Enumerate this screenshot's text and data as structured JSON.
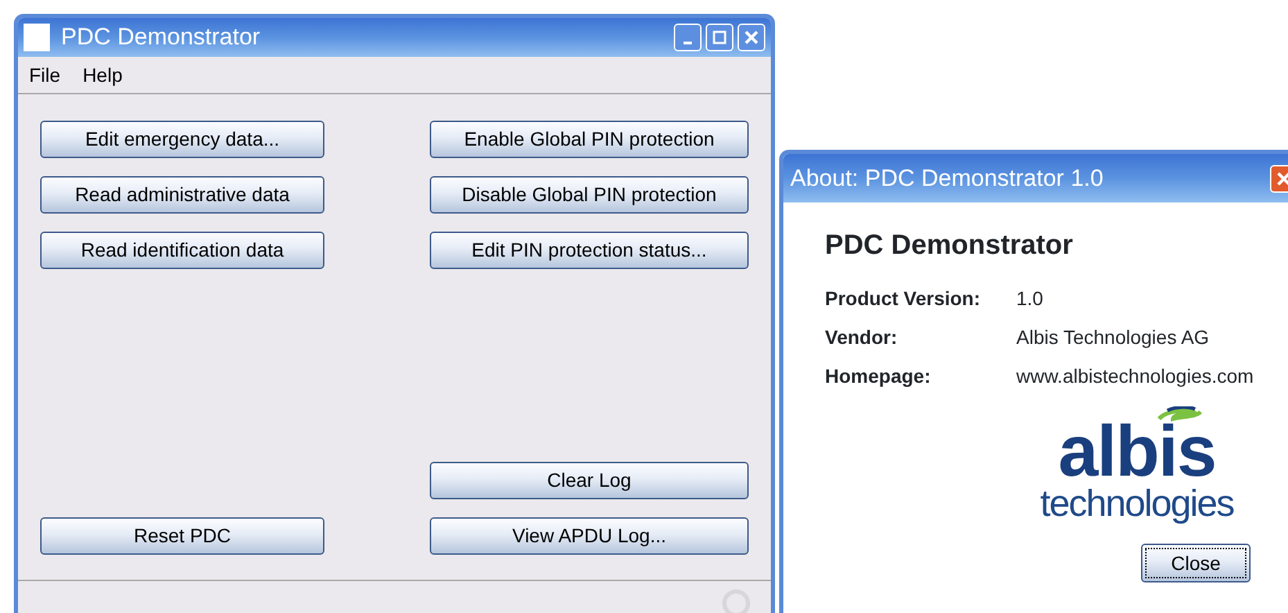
{
  "main_window": {
    "title": "PDC Demonstrator",
    "menu": [
      "File",
      "Help"
    ],
    "actions": {
      "top": [
        {
          "left": "Edit emergency data...",
          "right": "Enable Global PIN protection"
        },
        {
          "left": "Read administrative data",
          "right": "Disable Global PIN protection"
        },
        {
          "left": "Read identification data",
          "right": "Edit PIN protection status..."
        }
      ],
      "bottom": [
        {
          "right": "Clear Log"
        },
        {
          "left": "Reset PDC",
          "right": "View APDU Log..."
        }
      ]
    }
  },
  "about_dialog": {
    "title": "About: PDC Demonstrator 1.0",
    "heading": "PDC Demonstrator",
    "fields": [
      {
        "label": "Product Version:",
        "value": "1.0"
      },
      {
        "label": "Vendor:",
        "value": "Albis Technologies AG"
      },
      {
        "label": "Homepage:",
        "value": "www.albistechnologies.com"
      }
    ],
    "logo": {
      "name": "albis",
      "tagline": "technologies"
    },
    "button": "Close"
  }
}
